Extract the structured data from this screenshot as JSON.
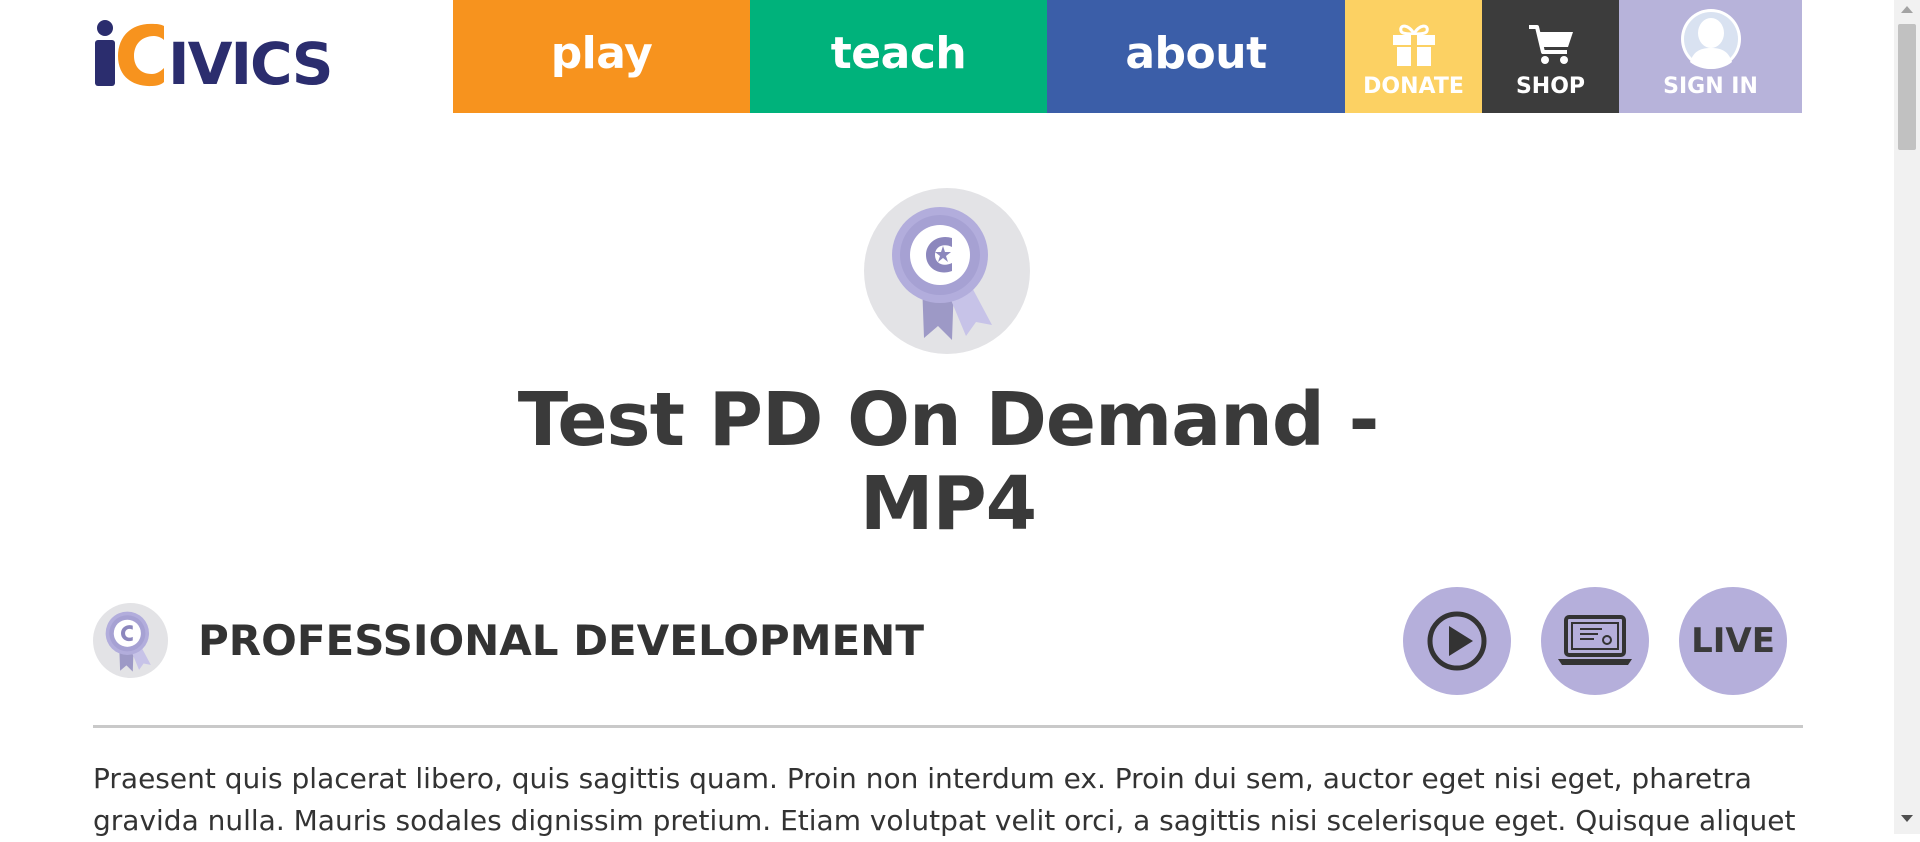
{
  "header": {
    "logo_text": "iCivics",
    "nav": {
      "play": "play",
      "teach": "teach",
      "about": "about",
      "donate": "DONATE",
      "shop": "SHOP",
      "signin": "SIGN IN"
    },
    "colors": {
      "play": "#f7931e",
      "teach": "#00b27b",
      "about": "#3b5ea8",
      "donate": "#fcd163",
      "shop": "#3c3c3c",
      "signin": "#b7b3da",
      "logo_navy": "#2b2d6e",
      "logo_orange": "#f7931e"
    },
    "icons": {
      "donate": "gift-icon",
      "shop": "cart-icon",
      "signin": "user-avatar-icon"
    }
  },
  "page": {
    "title": "Test PD On Demand - MP4",
    "badge_icon": "award-ribbon-icon"
  },
  "section": {
    "title": "PROFESSIONAL DEVELOPMENT",
    "format_icons": [
      "play-circle-icon",
      "computer-certificate-icon",
      "live-badge"
    ],
    "live_label": "LIVE",
    "accent": "#b5afdb"
  },
  "content": {
    "paragraph": "Praesent quis placerat libero, quis sagittis quam. Proin non interdum ex. Proin dui sem, auctor eget nisi eget, pharetra gravida nulla. Mauris sodales dignissim pretium. Etiam volutpat velit orci, a sagittis nisi scelerisque eget. Quisque aliquet"
  }
}
